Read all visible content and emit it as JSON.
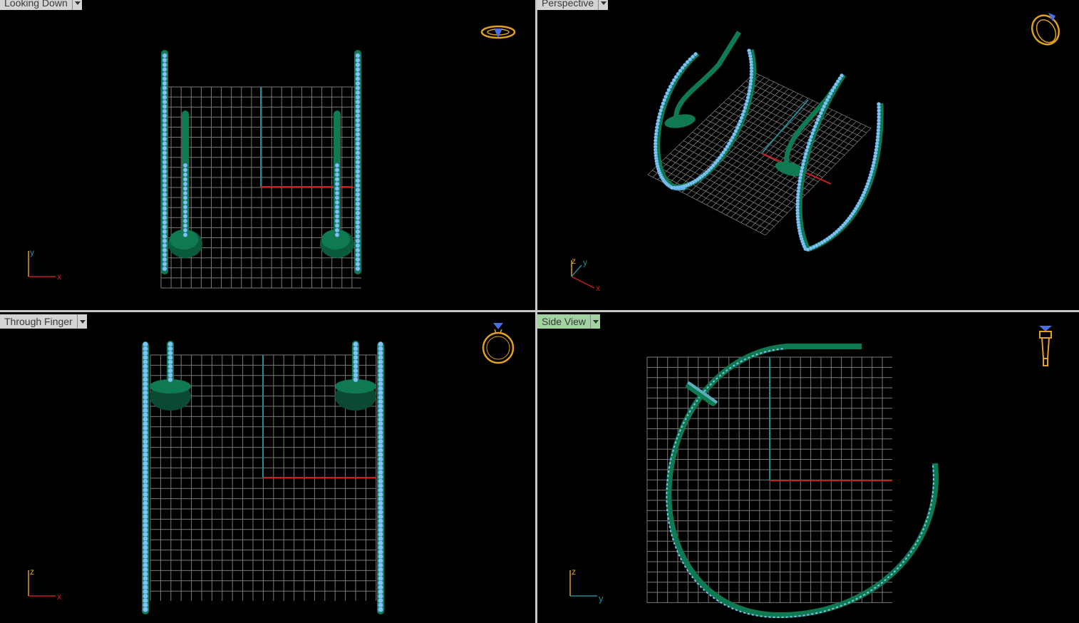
{
  "viewports": {
    "top_left": {
      "label": "Looking Down",
      "axis_h": "x",
      "axis_v": "y"
    },
    "top_right": {
      "label": "Perspective",
      "axis_h": "x",
      "axis_v": "y",
      "axis_z": "z"
    },
    "bottom_left": {
      "label": "Through Finger",
      "axis_h": "x",
      "axis_v": "z"
    },
    "bottom_right": {
      "label": "Side View",
      "axis_h": "y",
      "axis_v": "z",
      "active": true
    }
  },
  "colors": {
    "background": "#000000",
    "grid": "#8a8a8a",
    "axis_x": "#c81e1e",
    "axis_y": "#1e8c96",
    "ring_metal": "#0f7a52",
    "gem": "#7fc4f0",
    "nav_icon": "#e0a020",
    "label_bg": "#d4d4d4",
    "active_label_bg": "#9fd39f"
  },
  "icons": {
    "top_left": "ring-top-view-icon",
    "top_right": "ring-perspective-icon",
    "bottom_left": "ring-front-view-icon",
    "bottom_right": "ring-side-view-icon"
  }
}
